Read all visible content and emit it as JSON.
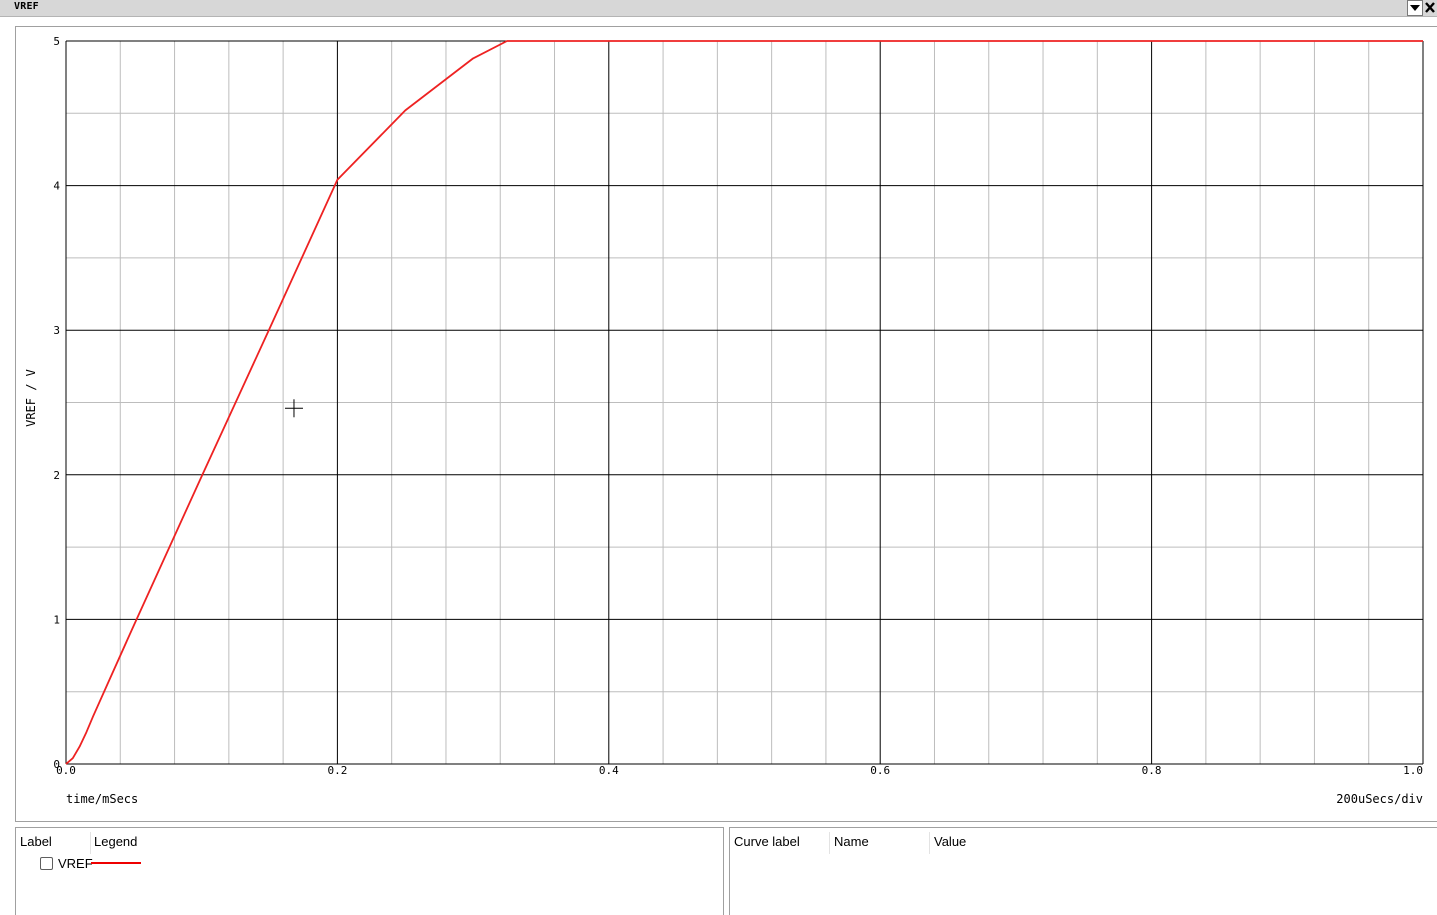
{
  "window": {
    "title": "VREF"
  },
  "chart_data": {
    "type": "line",
    "xlabel": "time/mSecs",
    "ylabel": "VREF / V",
    "scale_label": "200uSecs/div",
    "xlim": [
      0.0,
      1.0
    ],
    "ylim": [
      0,
      5
    ],
    "x_ticks": [
      "0.0",
      "0.2",
      "0.4",
      "0.6",
      "0.8",
      "1.0"
    ],
    "y_ticks": [
      "0",
      "1",
      "2",
      "3",
      "4",
      "5"
    ],
    "grid": true,
    "series": [
      {
        "name": "VREF",
        "color": "#ee2222",
        "x": [
          0.0,
          0.005,
          0.01,
          0.015,
          0.02,
          0.03,
          0.05,
          0.1,
          0.15,
          0.2,
          0.25,
          0.3,
          0.325,
          0.333,
          0.338,
          0.343,
          0.35,
          0.36,
          0.4,
          0.6,
          0.8,
          1.0
        ],
        "y": [
          0.0,
          0.04,
          0.12,
          0.22,
          0.33,
          0.54,
          0.96,
          1.99,
          3.01,
          4.04,
          4.52,
          4.88,
          5.0,
          5.0,
          5.0,
          5.0,
          5.0,
          5.0,
          5.0,
          5.0,
          5.0,
          5.0
        ]
      }
    ],
    "cursor": {
      "x": 0.168,
      "y": 2.46
    }
  },
  "legend_panel": {
    "headers": [
      "Label",
      "Legend"
    ],
    "items": [
      {
        "label": "VREF",
        "color": "#ee0000",
        "checked": false
      }
    ]
  },
  "curve_panel": {
    "headers": [
      "Curve label",
      "Name",
      "Value"
    ]
  }
}
